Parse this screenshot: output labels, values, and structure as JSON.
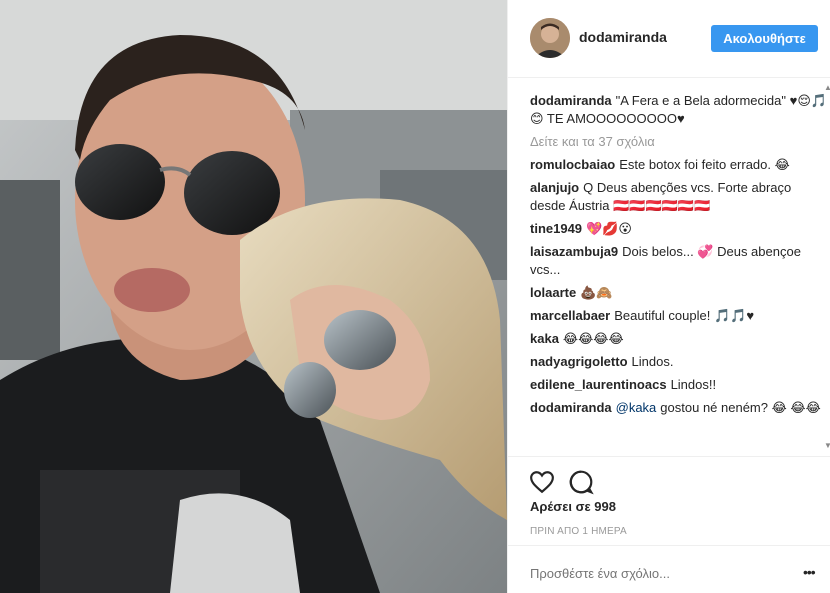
{
  "post": {
    "username": "dodamiranda",
    "follow_label": "Ακολουθήστε",
    "caption_user": "dodamiranda",
    "caption_text": "\"A Fera e a Bela adormecida\" ♥😌🎵😊 TE AMOOOOOOOOO♥",
    "view_all": "Δείτε και τα 37 σχόλια"
  },
  "comments": [
    {
      "user": "romulocbaiao",
      "mention": "",
      "text": "Este botox foi feito errado. 😂"
    },
    {
      "user": "alanjujo",
      "mention": "",
      "text": "Q Deus abenções vcs. Forte abraço desde Áustria 🇦🇹🇦🇹🇦🇹🇦🇹🇦🇹🇦🇹"
    },
    {
      "user": "tine1949",
      "mention": "",
      "text": "💖💋😮"
    },
    {
      "user": "laisazambuja9",
      "mention": "",
      "text": "Dois belos... 💞 Deus abençoe vcs..."
    },
    {
      "user": "lolaarte",
      "mention": "",
      "text": "💩🙈"
    },
    {
      "user": "marcellabaer",
      "mention": "",
      "text": "Beautiful couple! 🎵🎵♥"
    },
    {
      "user": "kaka",
      "mention": "",
      "text": "😂😂😂😂"
    },
    {
      "user": "nadyagrigoletto",
      "mention": "",
      "text": "Lindos."
    },
    {
      "user": "edilene_laurentinoacs",
      "mention": "",
      "text": "Lindos!!"
    },
    {
      "user": "dodamiranda",
      "mention": "@kaka",
      "text": "gostou né neném? 😂 😂😂"
    }
  ],
  "likes": "Αρέσει σε 998",
  "timestamp": "ΠΡΙΝ ΑΠΟ 1 ΗΜΕΡΑ",
  "add_comment_placeholder": "Προσθέστε ένα σχόλιο...",
  "options_label": "•••",
  "icons": {
    "like": "heart-icon",
    "comment": "speech-bubble-icon"
  },
  "colors": {
    "follow_button": "#3897f0",
    "mention": "#003569",
    "muted": "#999999"
  }
}
